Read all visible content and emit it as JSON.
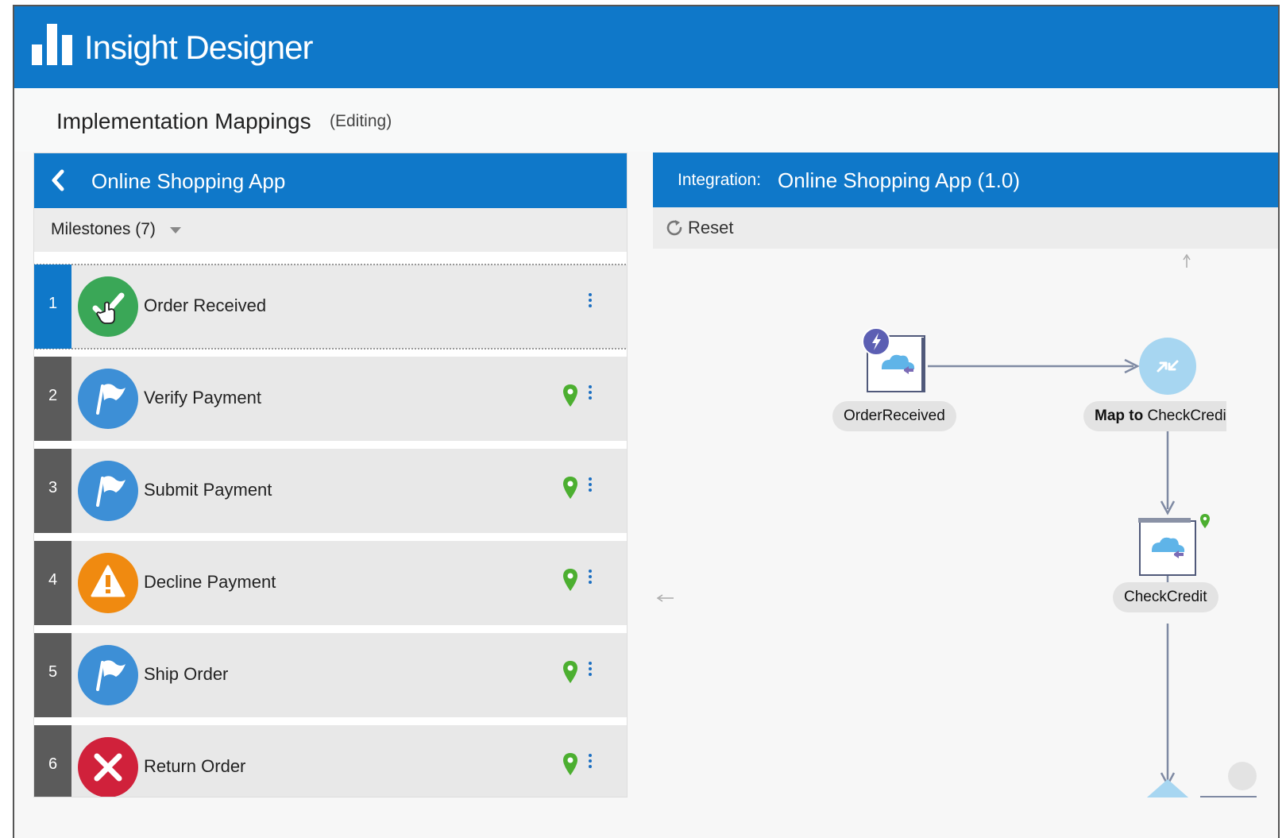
{
  "app": {
    "title": "Insight Designer"
  },
  "page": {
    "title": "Implementation Mappings",
    "mode": "(Editing)"
  },
  "left_panel": {
    "title": "Online Shopping App",
    "milestones_label": "Milestones (7)",
    "milestones": [
      {
        "num": "1",
        "label": "Order Received",
        "status": "complete",
        "color": "#3aa757"
      },
      {
        "num": "2",
        "label": "Verify Payment",
        "status": "flag",
        "color": "#3d8fd6"
      },
      {
        "num": "3",
        "label": "Submit Payment",
        "status": "flag",
        "color": "#3d8fd6"
      },
      {
        "num": "4",
        "label": "Decline Payment",
        "status": "warning",
        "color": "#f08a10"
      },
      {
        "num": "5",
        "label": "Ship Order",
        "status": "flag",
        "color": "#3d8fd6"
      },
      {
        "num": "6",
        "label": "Return Order",
        "status": "error",
        "color": "#d0213b"
      }
    ]
  },
  "right_panel": {
    "prefix": "Integration:",
    "title": "Online Shopping App (1.0)",
    "reset_label": "Reset",
    "nodes": {
      "trigger": "OrderReceived",
      "map_bold": "Map to",
      "map_rest": " CheckCredi",
      "invoke": "CheckCredit"
    }
  },
  "colors": {
    "brand": "#0f78c9",
    "pin": "#4caf30",
    "connector": "#7f8aa3"
  }
}
